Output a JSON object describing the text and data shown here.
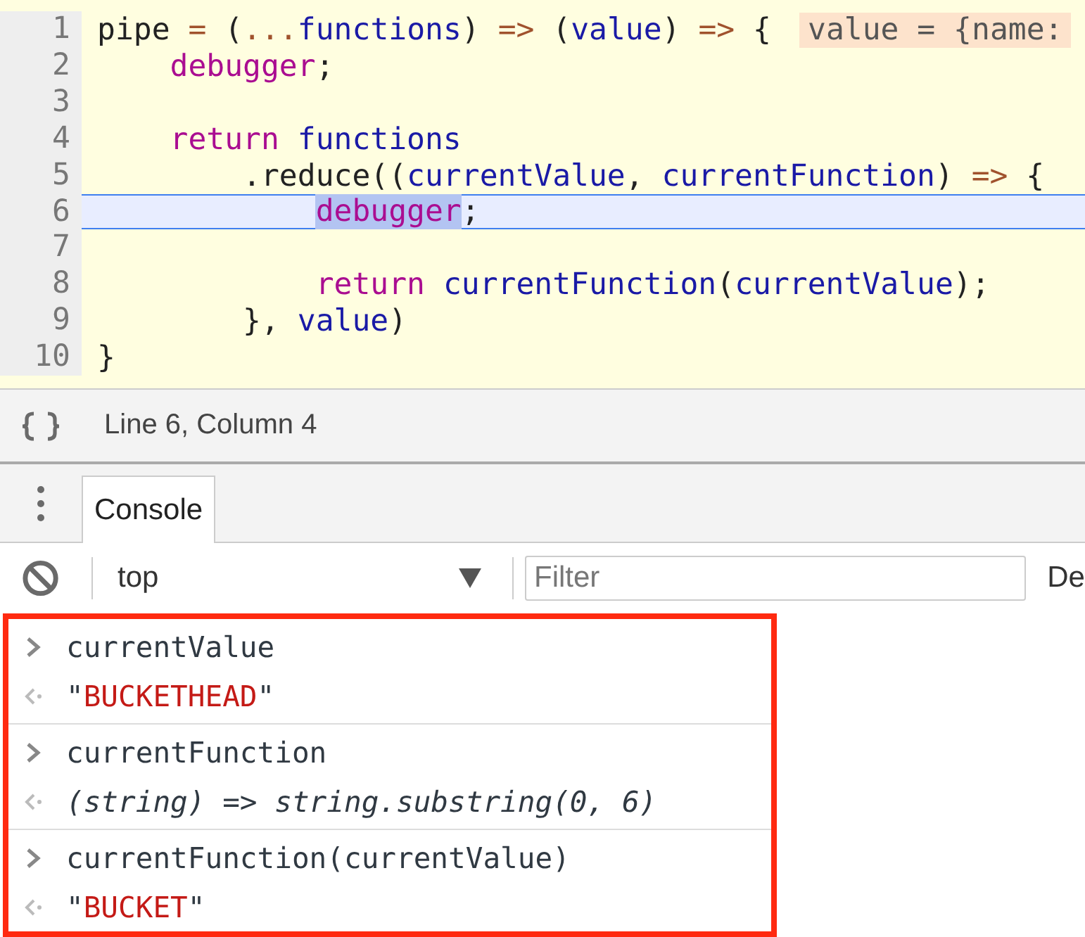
{
  "editor": {
    "lines": [
      {
        "number": "1",
        "current": false,
        "hint": "value = {name:",
        "tokens": [
          {
            "kind": "plain",
            "text": "pipe"
          },
          {
            "kind": "op",
            "text": " = "
          },
          {
            "kind": "plain",
            "text": "("
          },
          {
            "kind": "op",
            "text": "..."
          },
          {
            "kind": "var",
            "text": "functions"
          },
          {
            "kind": "plain",
            "text": ") "
          },
          {
            "kind": "op",
            "text": "=>"
          },
          {
            "kind": "plain",
            "text": " ("
          },
          {
            "kind": "var",
            "text": "value"
          },
          {
            "kind": "plain",
            "text": ") "
          },
          {
            "kind": "op",
            "text": "=>"
          },
          {
            "kind": "plain",
            "text": " {"
          }
        ],
        "children": [
          {
            "number": "2",
            "current": false,
            "tokens": [
              {
                "kind": "kw",
                "text": "debugger"
              },
              {
                "kind": "plain",
                "text": ";"
              }
            ]
          },
          {
            "number": "3",
            "current": false
          },
          {
            "number": "4",
            "current": false,
            "tokens": [
              {
                "kind": "kw",
                "text": "return "
              },
              {
                "kind": "var",
                "text": "functions"
              }
            ],
            "children": [
              {
                "number": "5",
                "current": false,
                "tokens": [
                  {
                    "kind": "plain",
                    "text": ".reduce(("
                  },
                  {
                    "kind": "var",
                    "text": "currentValue"
                  },
                  {
                    "kind": "plain",
                    "text": ", "
                  },
                  {
                    "kind": "var",
                    "text": "currentFunction"
                  },
                  {
                    "kind": "plain",
                    "text": ") "
                  },
                  {
                    "kind": "op",
                    "text": "=>"
                  },
                  {
                    "kind": "plain",
                    "text": " {"
                  }
                ],
                "children": [
                  {
                    "number": "6",
                    "current": true,
                    "tokens": [
                      {
                        "kind": "selection",
                        "text": "debugger"
                      },
                      {
                        "kind": "plain",
                        "text": ";"
                      }
                    ]
                  },
                  {
                    "number": "7",
                    "current": false
                  },
                  {
                    "number": "8",
                    "current": false,
                    "tokens": [
                      {
                        "kind": "kw",
                        "text": "return "
                      },
                      {
                        "kind": "var",
                        "text": "currentFunction"
                      },
                      {
                        "kind": "plain",
                        "text": "("
                      },
                      {
                        "kind": "var",
                        "text": "currentValue"
                      },
                      {
                        "kind": "plain",
                        "text": ");"
                      }
                    ]
                  }
                ]
              },
              {
                "number": "9",
                "current": false,
                "tokens": [
                  {
                    "kind": "plain",
                    "text": "}, "
                  },
                  {
                    "kind": "var",
                    "text": "value"
                  },
                  {
                    "kind": "plain",
                    "text": ")"
                  }
                ]
              }
            ]
          }
        ]
      },
      {
        "number": "10",
        "current": false,
        "tokens": [
          {
            "kind": "plain",
            "text": "}"
          }
        ]
      }
    ]
  },
  "status_bar": {
    "position": "Line 6, Column 4"
  },
  "drawer_tabs": [
    {
      "label": "Console",
      "selected": true
    }
  ],
  "console_toolbar": {
    "context": "top",
    "filter_placeholder": "Filter",
    "trailing_text": "De"
  },
  "console_entries": [
    {
      "input": "currentValue",
      "output": [
        {
          "kind": "quote",
          "text": "\""
        },
        {
          "kind": "string",
          "text": "BUCKETHEAD"
        },
        {
          "kind": "quote",
          "text": "\""
        }
      ]
    },
    {
      "input": "currentFunction",
      "output": [
        {
          "kind": "function",
          "text": "(string) => string.substring(0, 6)"
        }
      ]
    },
    {
      "input": "currentFunction(currentValue)",
      "output": [
        {
          "kind": "quote",
          "text": "\""
        },
        {
          "kind": "string",
          "text": "BUCKET"
        },
        {
          "kind": "quote",
          "text": "\""
        }
      ]
    }
  ]
}
